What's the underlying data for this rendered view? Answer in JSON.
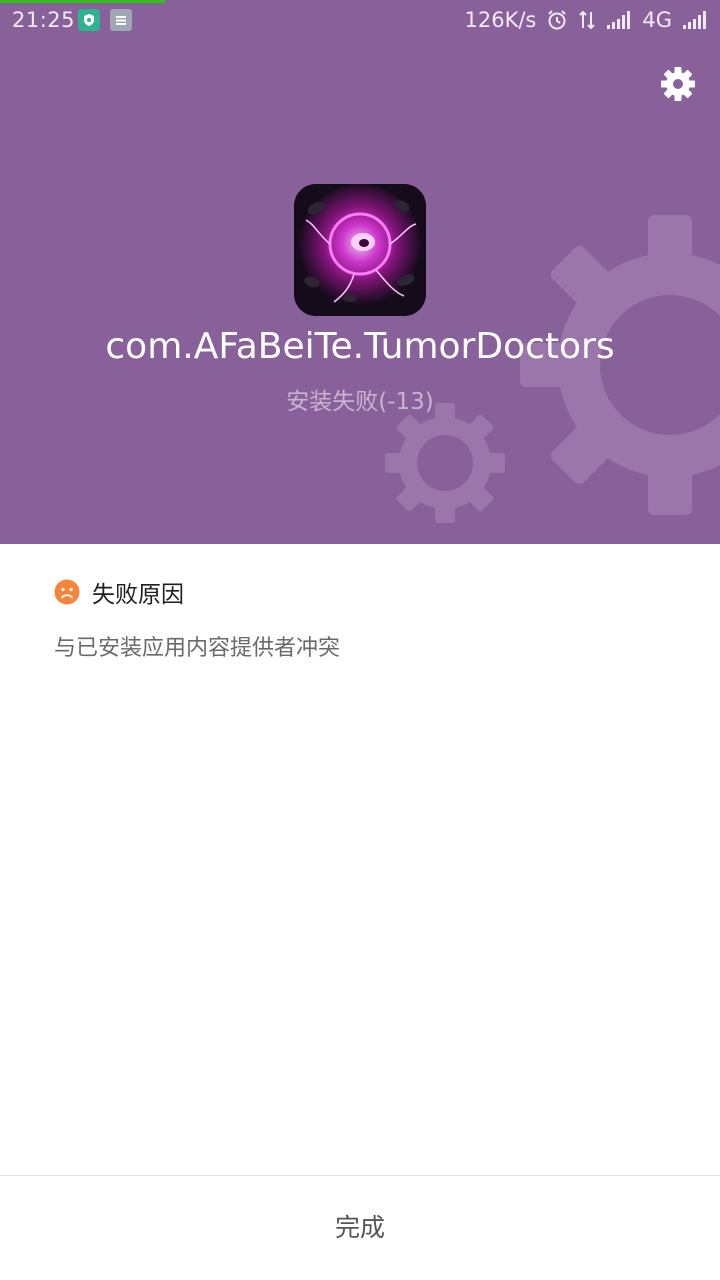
{
  "status_bar": {
    "time": "21:25",
    "net_speed": "126K/s",
    "network_type": "4G",
    "icons": [
      "shield-notification-icon",
      "document-notification-icon",
      "alarm-icon",
      "data-transfer-icon",
      "signal-icon",
      "signal-icon-2"
    ]
  },
  "header": {
    "settings_icon": "gear-icon",
    "package_name": "com.AFaBeiTe.TumorDoctors",
    "install_status": "安装失败(-13)"
  },
  "reason": {
    "title": "失败原因",
    "icon": "sad-face-icon",
    "text": "与已安装应用内容提供者冲突"
  },
  "footer": {
    "done_label": "完成"
  },
  "colors": {
    "header_bg": "#89619a",
    "accent_orange": "#f5853a",
    "progress_green": "#34c21a"
  }
}
